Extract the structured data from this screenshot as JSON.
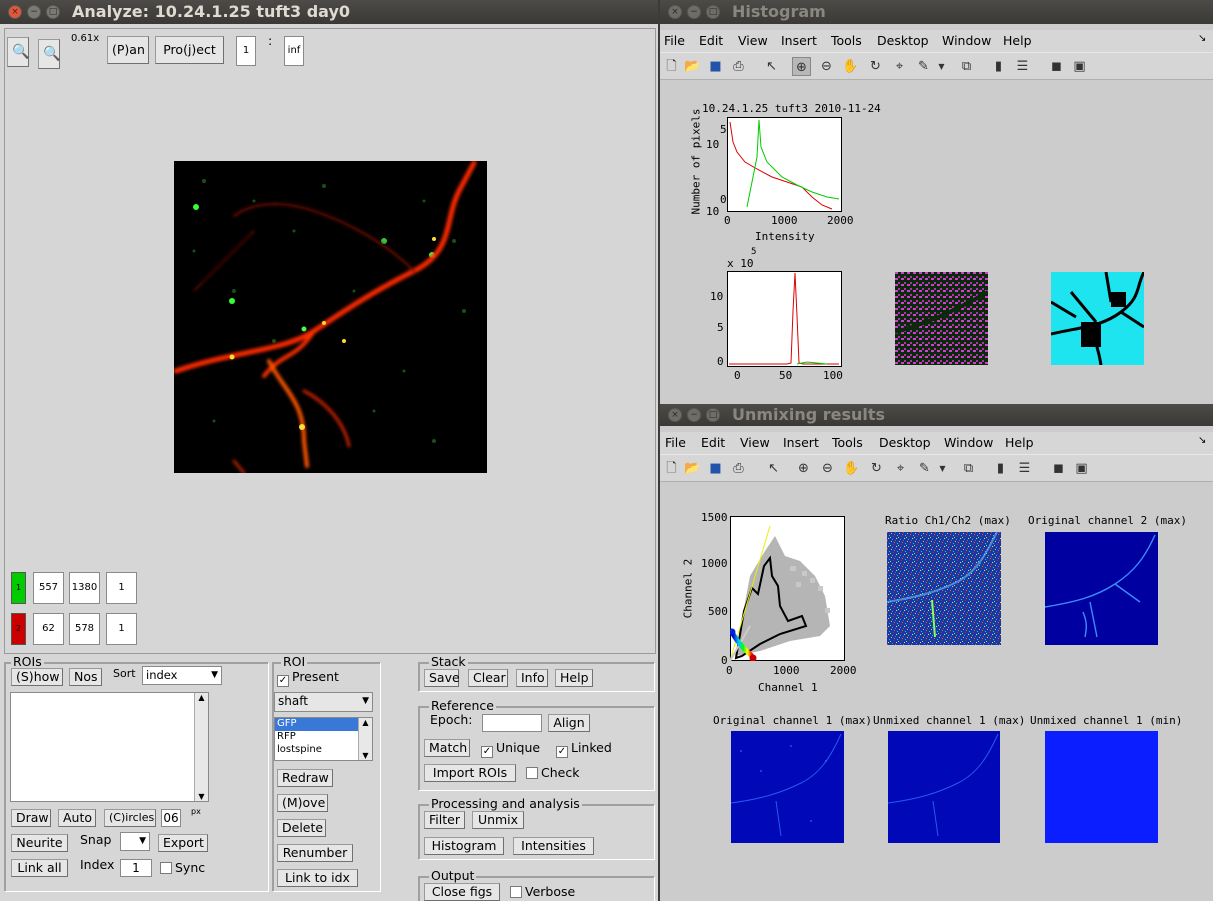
{
  "left": {
    "title": "Analyze: 10.24.1.25 tuft3  day0",
    "zoom": "0.61x",
    "pan": "(P)an",
    "project": "Pro(j)ect",
    "frame_start": "1",
    "frame_sep": ":",
    "frame_end": "inf",
    "ch1": {
      "id": "1",
      "min": "557",
      "max": "1380",
      "gamma": "1"
    },
    "ch2": {
      "id": "2",
      "min": "62",
      "max": "578",
      "gamma": "1"
    },
    "rois": {
      "title": "ROIs",
      "show": "(S)how",
      "nos": "Nos",
      "sort": "Sort",
      "sort_value": "index",
      "draw": "Draw",
      "auto": "Auto",
      "circles": "(C)ircles",
      "radius": "06",
      "px": "px",
      "neurite": "Neurite",
      "snap": "Snap",
      "export": "Export",
      "linkall": "Link all",
      "index": "Index",
      "index_value": "1",
      "sync": "Sync"
    },
    "roi": {
      "title": "ROI",
      "present": "Present",
      "type": "shaft",
      "list": [
        "GFP",
        "RFP",
        "lostspine"
      ],
      "redraw": "Redraw",
      "move": "(M)ove",
      "delete": "Delete",
      "renumber": "Renumber",
      "linkidx": "Link to idx"
    },
    "stack": {
      "title": "Stack",
      "save": "Save",
      "clear": "Clear",
      "info": "Info",
      "help": "Help"
    },
    "reference": {
      "title": "Reference",
      "epoch": "Epoch:",
      "align": "Align",
      "match": "Match",
      "unique": "Unique",
      "linked": "Linked",
      "import": "Import ROIs",
      "check": "Check"
    },
    "proc": {
      "title": "Processing and analysis",
      "filter": "Filter",
      "unmix": "Unmix",
      "histogram": "Histogram",
      "intensities": "Intensities"
    },
    "output": {
      "title": "Output",
      "closefigs": "Close figs",
      "verbose": "Verbose"
    }
  },
  "histogram": {
    "title": "Histogram",
    "menu": [
      "File",
      "Edit",
      "View",
      "Insert",
      "Tools",
      "Desktop",
      "Window",
      "Help"
    ],
    "plot1": {
      "title": "10.24.1.25 tuft3 2010-11-24",
      "ylabel": "Number of pixels",
      "xlabel": "Intensity",
      "yticks": [
        "5",
        "10",
        "0",
        "10"
      ],
      "xticks": [
        "0",
        "1000",
        "2000"
      ]
    },
    "plot2": {
      "exp": "x 10",
      "exp_pow": "5",
      "yticks": [
        "10",
        "5",
        "0"
      ],
      "xticks": [
        "0",
        "50",
        "100"
      ]
    }
  },
  "unmixing": {
    "title": "Unmixing results",
    "menu": [
      "File",
      "Edit",
      "View",
      "Insert",
      "Tools",
      "Desktop",
      "Window",
      "Help"
    ],
    "scatter": {
      "xlabel": "Channel 1",
      "ylabel": "Channel 2",
      "yticks": [
        "1500",
        "1000",
        "500",
        "0"
      ],
      "xticks": [
        "0",
        "1000",
        "2000"
      ]
    },
    "img_titles": [
      "Ratio Ch1/Ch2 (max)",
      "Original channel 2 (max)",
      "Original channel 1 (max)",
      "Unmixed channel 1 (max)",
      "Unmixed channel 1 (min)"
    ]
  },
  "colors": {
    "titlebar": "#3c3b37",
    "close": "#e0593c",
    "green": "#00cc00",
    "red": "#cc0000"
  }
}
